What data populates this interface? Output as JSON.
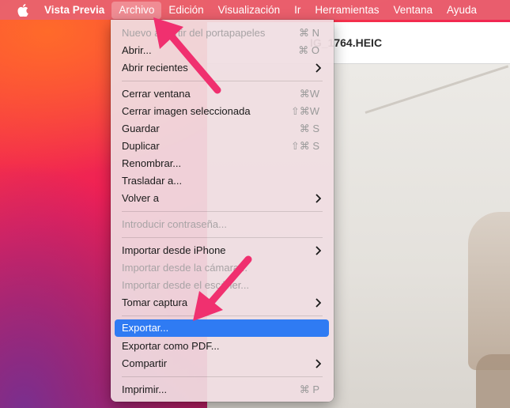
{
  "menubar": {
    "app_name": "Vista Previa",
    "items": [
      "Archivo",
      "Edición",
      "Visualización",
      "Ir",
      "Herramientas",
      "Ventana",
      "Ayuda"
    ]
  },
  "window": {
    "title": "IMG_1764.HEIC",
    "title_visible": "IG_1764.HEIC"
  },
  "menu": {
    "items": [
      {
        "label": "Nuevo a partir del portapapeles",
        "shortcut": "⌘ N",
        "disabled": true
      },
      {
        "label": "Abrir...",
        "shortcut": "⌘ O"
      },
      {
        "label": "Abrir recientes",
        "submenu": true
      },
      {
        "label": "Cerrar ventana",
        "shortcut": "⌘W"
      },
      {
        "label": "Cerrar imagen seleccionada",
        "shortcut": "⇧⌘W"
      },
      {
        "label": "Guardar",
        "shortcut": "⌘ S"
      },
      {
        "label": "Duplicar",
        "shortcut": "⇧⌘ S"
      },
      {
        "label": "Renombrar..."
      },
      {
        "label": "Trasladar a..."
      },
      {
        "label": "Volver a",
        "submenu": true
      },
      {
        "label": "Introducir contraseña...",
        "disabled": true
      },
      {
        "label": "Importar desde iPhone",
        "submenu": true
      },
      {
        "label": "Importar desde la cámara...",
        "disabled": true
      },
      {
        "label": "Importar desde el escáner...",
        "disabled": true
      },
      {
        "label": "Tomar captura",
        "submenu": true
      },
      {
        "label": "Exportar...",
        "selected": true
      },
      {
        "label": "Exportar como PDF..."
      },
      {
        "label": "Compartir",
        "submenu": true
      },
      {
        "label": "Imprimir...",
        "shortcut": "⌘ P"
      }
    ]
  },
  "colors": {
    "accent": "#2f7bf3",
    "arrow": "#f0306f"
  }
}
